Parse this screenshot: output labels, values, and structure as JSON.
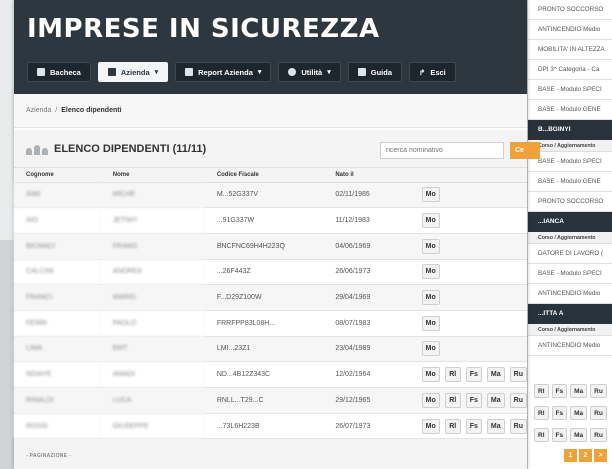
{
  "app_title": "IMPRESE IN SICUREZZA",
  "nav": [
    {
      "label": "Bacheca",
      "active": false,
      "dropdown": false
    },
    {
      "label": "Azienda",
      "active": true,
      "dropdown": true
    },
    {
      "label": "Report Azienda",
      "active": false,
      "dropdown": true
    },
    {
      "label": "Utilità",
      "active": false,
      "dropdown": true
    },
    {
      "label": "Guida",
      "active": false,
      "dropdown": false
    },
    {
      "label": "Esci",
      "active": false,
      "dropdown": false
    }
  ],
  "breadcrumb": {
    "parent": "Azienda",
    "separator": "/",
    "current": "Elenco dipendenti"
  },
  "panel": {
    "title": "ELENCO DIPENDENTI (11/11)",
    "search_placeholder": "ricerca nominativo",
    "search_button": "Ce"
  },
  "table": {
    "headers": [
      "Cognome",
      "Nome",
      "Codice Fiscale",
      "Nato il"
    ],
    "rows": [
      {
        "cognome": "AIMI",
        "nome": "MICHE",
        "cf": "M...52G337V",
        "nato": "02/11/1985",
        "actions": [
          "Mo"
        ]
      },
      {
        "cognome": "AIO",
        "nome": "JETIMY",
        "cf": "...91G337W",
        "nato": "11/12/1983",
        "actions": [
          "Mo"
        ]
      },
      {
        "cognome": "BICMACI",
        "nome": "FRAMS",
        "cf": "BNCFNC69H4H223Q",
        "nato": "04/06/1969",
        "actions": [
          "Mo"
        ]
      },
      {
        "cognome": "CALCINI",
        "nome": "ANDREA",
        "cf": "...26F443Z",
        "nato": "26/06/1973",
        "actions": [
          "Mo"
        ]
      },
      {
        "cognome": "FRANCI",
        "nome": "MARIO",
        "cf": "F...D29Z100W",
        "nato": "29/04/1969",
        "actions": [
          "Mo"
        ]
      },
      {
        "cognome": "FERRI",
        "nome": "PAOLO",
        "cf": "FRRFPP83L08H...",
        "nato": "08/07/1983",
        "actions": [
          "Mo"
        ]
      },
      {
        "cognome": "LIMA",
        "nome": "EMT",
        "cf": "LMI...23Z1",
        "nato": "23/04/1989",
        "actions": [
          "Mo"
        ]
      },
      {
        "cognome": "NDIAYE",
        "nome": "AMADI",
        "cf": "ND...4B12Z343C",
        "nato": "12/02/1964",
        "actions": [
          "Mo",
          "Rl",
          "Fs",
          "Ma",
          "Ru"
        ]
      },
      {
        "cognome": "RINALDI",
        "nome": "LUCA",
        "cf": "RNLL...T29...C",
        "nato": "29/12/1965",
        "actions": [
          "Mo",
          "Rl",
          "Fs",
          "Ma",
          "Ru"
        ]
      },
      {
        "cognome": "ROSSI",
        "nome": "GIUSEPPE",
        "cf": "...73L6H223B",
        "nato": "26/07/1973",
        "actions": [
          "Mo",
          "Rl",
          "Fs",
          "Ma",
          "Ru"
        ]
      }
    ]
  },
  "pagination_label": "- PAGINAZIONE -",
  "right_panel": {
    "items": [
      {
        "kind": "item",
        "text": "PRONTO SOCCORSO"
      },
      {
        "kind": "item",
        "text": "ANTINCENDIO Medio"
      },
      {
        "kind": "item",
        "text": "MOBILITA' IN ALTEZZA"
      },
      {
        "kind": "item",
        "text": "DPI 3^ Categoria - Ca"
      },
      {
        "kind": "item",
        "text": "BASE - Modulo SPECI"
      },
      {
        "kind": "item",
        "text": "BASE - Modulo GENE"
      },
      {
        "kind": "dark",
        "text": "B...BGINYI"
      },
      {
        "kind": "sub",
        "text": "Corso / Aggiornamento"
      },
      {
        "kind": "item",
        "text": "BASE - Modulo SPECI"
      },
      {
        "kind": "item",
        "text": "BASE - Modulo GENE"
      },
      {
        "kind": "item",
        "text": "PRONTO SOCCORSO"
      },
      {
        "kind": "dark",
        "text": "...IANCA"
      },
      {
        "kind": "sub",
        "text": "Corso / Aggiornamento"
      },
      {
        "kind": "item",
        "text": "DATORE DI LAVORO ("
      },
      {
        "kind": "item",
        "text": "BASE - Modulo SPECI"
      },
      {
        "kind": "item",
        "text": "ANTINCENDIO Medio"
      },
      {
        "kind": "dark",
        "text": "...ITTA A"
      },
      {
        "kind": "sub",
        "text": "Corso / Aggiornamento"
      },
      {
        "kind": "item",
        "text": "ANTINCENDIO Medio"
      }
    ],
    "row_buttons": [
      "Rl",
      "Fs",
      "Ma",
      "Ru"
    ],
    "pagination": [
      "1",
      "2",
      ">"
    ]
  },
  "colors": {
    "header_bg": "#2d373f",
    "accent": "#f0a23a",
    "panel_bg": "#f4f4f4"
  },
  "icons": {
    "bacheca": "dashboard-icon",
    "azienda": "building-icon",
    "report": "report-icon",
    "utilita": "gear-icon",
    "guida": "book-icon",
    "esci": "exit-icon",
    "panel": "people-icon"
  }
}
